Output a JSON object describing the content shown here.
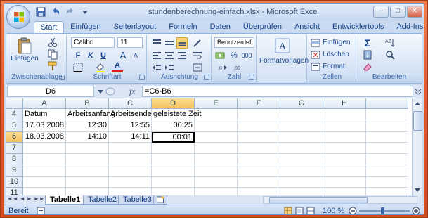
{
  "window": {
    "title": "stundenberechnung-einfach.xlsx - Microsoft Excel",
    "controls": [
      "–",
      "□",
      "✕"
    ]
  },
  "tabs": [
    "Start",
    "Einfügen",
    "Seitenlayout",
    "Formeln",
    "Daten",
    "Überprüfen",
    "Ansicht",
    "Entwicklertools",
    "Add-Ins"
  ],
  "ribbon": {
    "clipboard": {
      "paste_label": "Einfügen",
      "group_label": "Zwischenablage"
    },
    "font": {
      "font_name": "Calibri",
      "font_size": "11",
      "bold": "F",
      "italic": "K",
      "underline": "U",
      "grow": "A",
      "shrink": "A",
      "font_color": "A",
      "group_label": "Schriftart"
    },
    "alignment": {
      "group_label": "Ausrichtung"
    },
    "number": {
      "format_value": "Benutzerdef",
      "percent": "%",
      "thousands": "000",
      "group_label": "Zahl"
    },
    "styles": {
      "label": "Formatvorlagen",
      "icon_letter": "A"
    },
    "cells": {
      "insert": "Einfügen",
      "delete": "Löschen",
      "format": "Format",
      "group_label": "Zellen"
    },
    "editing": {
      "sum": "Σ",
      "group_label": "Bearbeiten"
    }
  },
  "formula_bar": {
    "name_box": "D6",
    "fx": "fx",
    "formula": "=C6-B6"
  },
  "grid": {
    "columns": [
      "A",
      "B",
      "C",
      "D",
      "E",
      "F",
      "G",
      "H"
    ],
    "selected_column": "D",
    "selected_row": "6",
    "rows": [
      {
        "num": "4",
        "cells": [
          "Datum",
          "Arbeitsanfang",
          "Arbeitsende",
          "geleistete Zeit",
          "",
          "",
          "",
          ""
        ]
      },
      {
        "num": "5",
        "cells": [
          "17.03.2008",
          "12:30",
          "12:55",
          "00:25",
          "",
          "",
          "",
          ""
        ]
      },
      {
        "num": "6",
        "cells": [
          "18.03.2008",
          "14:10",
          "14:11",
          "00:01",
          "",
          "",
          "",
          ""
        ]
      },
      {
        "num": "7",
        "cells": [
          "",
          "",
          "",
          "",
          "",
          "",
          "",
          ""
        ]
      },
      {
        "num": "8",
        "cells": [
          "",
          "",
          "",
          "",
          "",
          "",
          "",
          ""
        ]
      },
      {
        "num": "9",
        "cells": [
          "",
          "",
          "",
          "",
          "",
          "",
          "",
          ""
        ]
      },
      {
        "num": "10",
        "cells": [
          "",
          "",
          "",
          "",
          "",
          "",
          "",
          ""
        ]
      },
      {
        "num": "11",
        "cells": [
          "",
          "",
          "",
          "",
          "",
          "",
          "",
          ""
        ]
      }
    ]
  },
  "sheets": {
    "tabs": [
      "Tabelle1",
      "Tabelle2",
      "Tabelle3"
    ],
    "active": "Tabelle1"
  },
  "status": {
    "mode": "Bereit",
    "zoom": "100 %"
  }
}
